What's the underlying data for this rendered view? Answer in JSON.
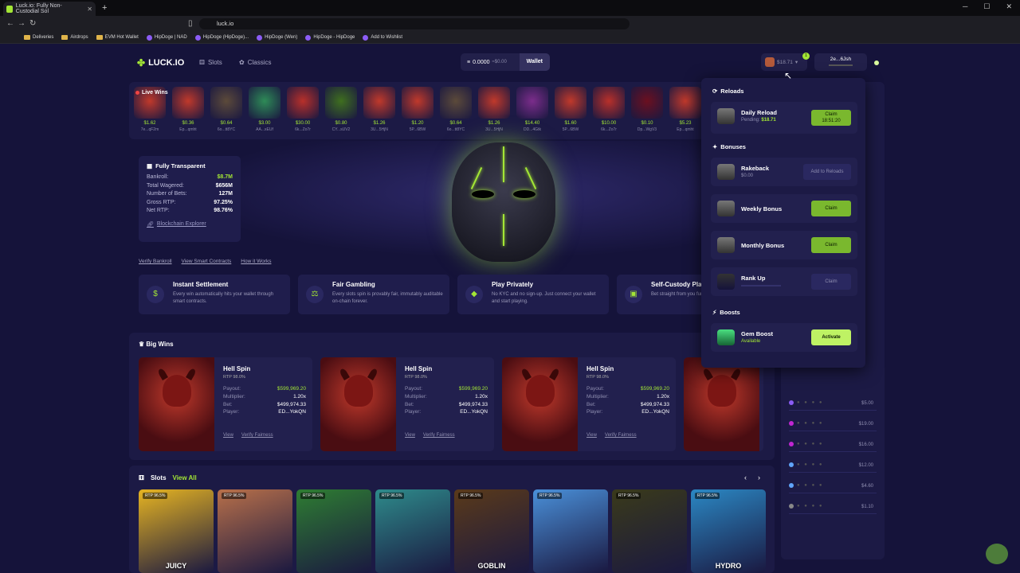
{
  "browser": {
    "tab_title": "Luck.io: Fully Non-Custodial Sol",
    "url": "luck.io",
    "bookmarks": [
      "Deliveries",
      "Airdrops",
      "EVM Hot Wallet",
      "HipDoge | NAD",
      "HipDoge (HipDoge)...",
      "HipDoge (Wen)",
      "HipDoge - HipDoge",
      "Add to Wishlist"
    ]
  },
  "header": {
    "logo": "LUCK.IO",
    "nav": [
      "Slots",
      "Classics"
    ],
    "balance": "0.0000",
    "balance_usd": "≈$0.00",
    "wallet_label": "Wallet",
    "bal_chip": "$18.71",
    "badge_count": "1",
    "address": "2e...6Jsh"
  },
  "live_wins": {
    "title": "Live Wins",
    "items": [
      {
        "amt": "$1.62",
        "user": "7e...qF2m",
        "color": "#c0392b"
      },
      {
        "amt": "$0.36",
        "user": "Ep...qmht",
        "color": "#c0392b"
      },
      {
        "amt": "$0.64",
        "user": "6o...tt8YC",
        "color": "#5c4a3a"
      },
      {
        "amt": "$3.00",
        "user": "AA...xEUf",
        "color": "#2e8b57"
      },
      {
        "amt": "$30.00",
        "user": "6k...Zo7r",
        "color": "#b8302a"
      },
      {
        "amt": "$0.80",
        "user": "CY...sUV2",
        "color": "#3f6f1f"
      },
      {
        "amt": "$1.26",
        "user": "3U...5HjN",
        "color": "#c0392b"
      },
      {
        "amt": "$1.20",
        "user": "5P...6BW",
        "color": "#c0392b"
      },
      {
        "amt": "$0.64",
        "user": "6o...tt8YC",
        "color": "#5c4a3a"
      },
      {
        "amt": "$1.26",
        "user": "3U...5HjN",
        "color": "#c0392b"
      },
      {
        "amt": "$14.40",
        "user": "DD...4Gtk",
        "color": "#7b2d8b"
      },
      {
        "amt": "$1.60",
        "user": "5P...6BW",
        "color": "#c0392b"
      },
      {
        "amt": "$10.00",
        "user": "6k...Zo7r",
        "color": "#b8302a"
      },
      {
        "amt": "$0.10",
        "user": "Dp...WgV3",
        "color": "#6b1020"
      },
      {
        "amt": "$5.23",
        "user": "Ep...qmht",
        "color": "#c0392b"
      }
    ]
  },
  "transparency": {
    "title": "Fully Transparent",
    "rows": [
      {
        "label": "Bankroll:",
        "value": "$8.7M"
      },
      {
        "label": "Total Wagered:",
        "value": "$656M"
      },
      {
        "label": "Number of Bets:",
        "value": "127M"
      },
      {
        "label": "Gross RTP:",
        "value": "97.25%"
      },
      {
        "label": "Net RTP:",
        "value": "98.76%"
      }
    ],
    "explorer": "Blockchain Explorer",
    "verify": [
      "Verify Bankroll",
      "View Smart Contracts",
      "How it Works"
    ]
  },
  "features": [
    {
      "title": "Instant Settlement",
      "desc": "Every win automatically hits your wallet through smart contracts.",
      "icon": "$"
    },
    {
      "title": "Fair Gambling",
      "desc": "Every slots spin is provably fair, immutably auditable on-chain forever.",
      "icon": "⚖"
    },
    {
      "title": "Play Privately",
      "desc": "No KYC and no sign-up. Just connect your wallet and start playing.",
      "icon": "◆"
    },
    {
      "title": "Self-Custody Play",
      "desc": "Bet straight from you funds always in your",
      "icon": "▣"
    }
  ],
  "big_wins": {
    "title": "Big Wins",
    "cards": [
      {
        "game": "Hell Spin",
        "rtp": "RTP 98.0%",
        "payout": "$599,969.20",
        "multiplier": "1.20x",
        "bet": "$499,974.33",
        "player": "ED...YokQN"
      },
      {
        "game": "Hell Spin",
        "rtp": "RTP 98.0%",
        "payout": "$599,969.20",
        "multiplier": "1.20x",
        "bet": "$499,974.33",
        "player": "ED...YokQN"
      },
      {
        "game": "Hell Spin",
        "rtp": "RTP 98.0%",
        "payout": "$599,969.20",
        "multiplier": "1.20x",
        "bet": "$499,974.33",
        "player": "ED...YokQN"
      }
    ],
    "labels": {
      "payout": "Payout:",
      "multiplier": "Multiplier:",
      "bet": "Bet:",
      "player": "Player:",
      "view": "View",
      "verify": "Verify Fairness"
    }
  },
  "slots": {
    "title": "Slots",
    "view_all": "View All",
    "items": [
      {
        "name": "JUICY",
        "rtp": "RTP 96.5%",
        "color": "#e6b422"
      },
      {
        "name": "",
        "rtp": "RTP 96.5%",
        "color": "#b8704a"
      },
      {
        "name": "",
        "rtp": "RTP 96.5%",
        "color": "#2e7d32"
      },
      {
        "name": "",
        "rtp": "RTP 96.5%",
        "color": "#2e8b8b"
      },
      {
        "name": "GOBLIN",
        "rtp": "RTP 96.5%",
        "color": "#5a3a1a"
      },
      {
        "name": "",
        "rtp": "RTP 96.5%",
        "color": "#4a90d9"
      },
      {
        "name": "",
        "rtp": "RTP 96.5%",
        "color": "#3a3a1a"
      },
      {
        "name": "HYDRO",
        "rtp": "RTP 96.5%",
        "color": "#2b88c4"
      }
    ]
  },
  "sidebar": {
    "rows": [
      {
        "val": "$5.00",
        "color": "#8b5cf6"
      },
      {
        "val": "$19.00",
        "color": "#c026d3"
      },
      {
        "val": "$16.00",
        "color": "#c026d3"
      },
      {
        "val": "$12.00",
        "color": "#60a5fa"
      },
      {
        "val": "$4.60",
        "color": "#60a5fa"
      },
      {
        "val": "$1.10",
        "color": "#888"
      }
    ],
    "dots": "● ● ● ●"
  },
  "dropdown": {
    "reloads_title": "Reloads",
    "daily_reload": {
      "title": "Daily Reload",
      "pending_label": "Pending:",
      "pending_val": "$18.71",
      "btn": "Claim",
      "btn_sub": "18:51:20"
    },
    "bonuses_title": "Bonuses",
    "rakeback": {
      "title": "Rakeback",
      "sub": "$0.00",
      "btn": "Add to Reloads"
    },
    "weekly": {
      "title": "Weekly Bonus",
      "btn": "Claim"
    },
    "monthly": {
      "title": "Monthly Bonus",
      "btn": "Claim"
    },
    "rankup": {
      "title": "Rank Up",
      "btn": "Claim"
    },
    "boosts_title": "Boosts",
    "gem": {
      "title": "Gem Boost",
      "sub": "Available",
      "btn": "Activate"
    }
  }
}
